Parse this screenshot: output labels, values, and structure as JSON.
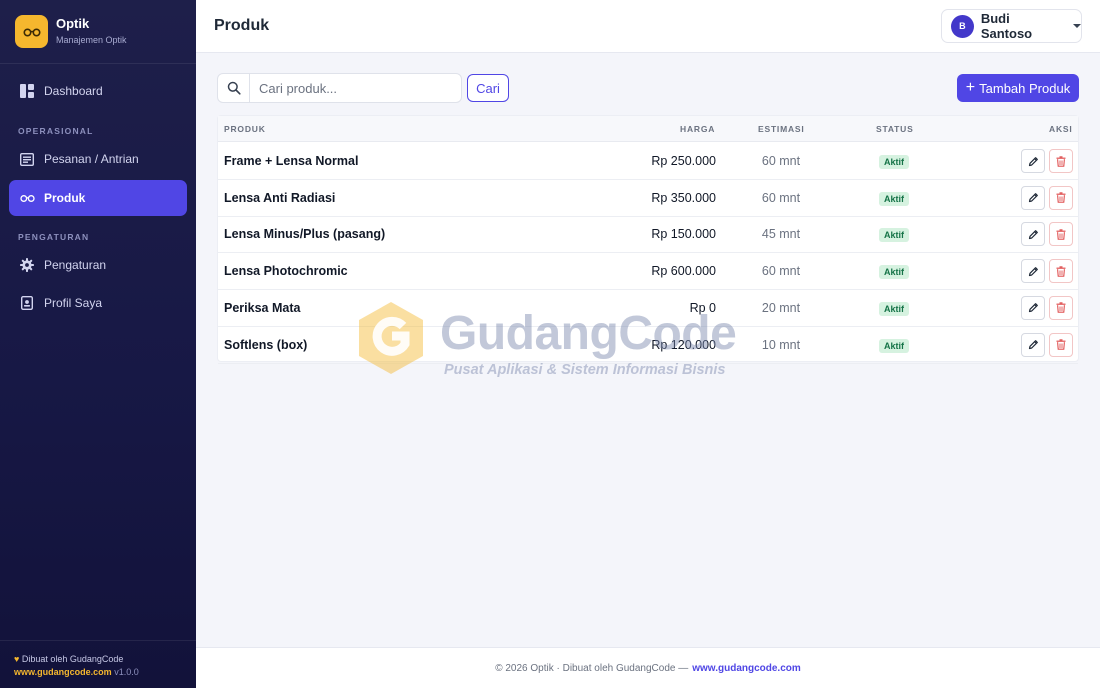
{
  "brand": {
    "title": "Optik",
    "subtitle": "Manajemen Optik",
    "icon": "glasses-icon",
    "color": "#f5b72e"
  },
  "sidebar": {
    "items": [
      {
        "label": "Dashboard",
        "icon": "dashboard-icon"
      },
      {
        "section": "OPERASIONAL"
      },
      {
        "label": "Pesanan / Antrian",
        "icon": "list-icon"
      },
      {
        "label": "Produk",
        "icon": "glasses-icon",
        "active": true
      },
      {
        "section": "PENGATURAN"
      },
      {
        "label": "Pengaturan",
        "icon": "gear-icon"
      },
      {
        "label": "Profil Saya",
        "icon": "id-badge-icon"
      }
    ],
    "footer": {
      "credit": "Dibuat oleh GudangCode",
      "link": "www.gudangcode.com",
      "version": "v1.0.0"
    }
  },
  "header": {
    "title": "Produk",
    "user": {
      "initial": "B",
      "name": "Budi Santoso"
    }
  },
  "toolbar": {
    "search_placeholder": "Cari produk...",
    "search_value": "",
    "search_button": "Cari",
    "add_button": "Tambah Produk"
  },
  "table": {
    "headers": {
      "product": "PRODUK",
      "price": "HARGA",
      "estimate": "ESTIMASI",
      "status": "STATUS",
      "actions": "AKSI"
    },
    "rows": [
      {
        "name": "Frame + Lensa Normal",
        "price": "Rp 250.000",
        "estimate": "60 mnt",
        "status": "Aktif"
      },
      {
        "name": "Lensa Anti Radiasi",
        "price": "Rp 350.000",
        "estimate": "60 mnt",
        "status": "Aktif"
      },
      {
        "name": "Lensa Minus/Plus (pasang)",
        "price": "Rp 150.000",
        "estimate": "45 mnt",
        "status": "Aktif"
      },
      {
        "name": "Lensa Photochromic",
        "price": "Rp 600.000",
        "estimate": "60 mnt",
        "status": "Aktif"
      },
      {
        "name": "Periksa Mata",
        "price": "Rp 0",
        "estimate": "20 mnt",
        "status": "Aktif"
      },
      {
        "name": "Softlens (box)",
        "price": "Rp 120.000",
        "estimate": "10 mnt",
        "status": "Aktif"
      }
    ]
  },
  "watermark": {
    "title": "GudangCode",
    "subtitle": "Pusat Aplikasi & Sistem Informasi Bisnis"
  },
  "footer": {
    "text": "© 2026 Optik · Dibuat oleh GudangCode —",
    "link": "www.gudangcode.com"
  },
  "colors": {
    "accent": "#5046e5",
    "sidebar": "#1e1f4a",
    "badge_bg": "#d6f2e0",
    "badge_text": "#157347",
    "danger": "#e05252"
  }
}
